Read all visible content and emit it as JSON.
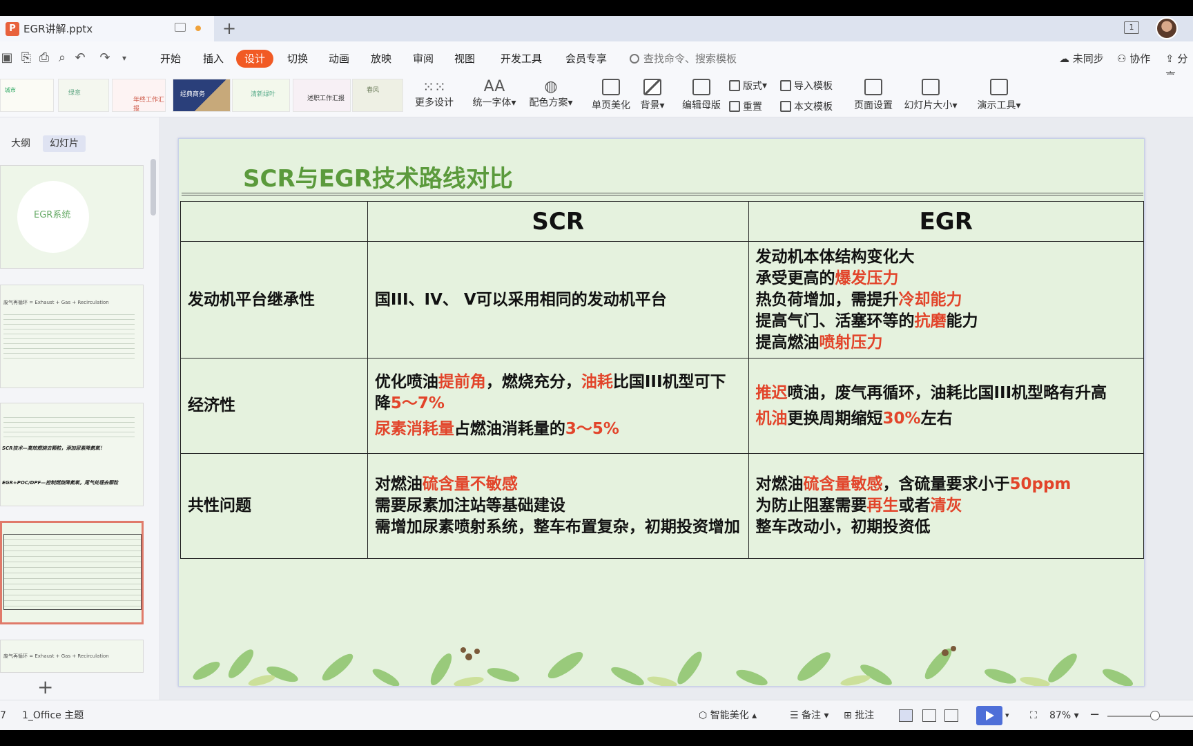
{
  "window": {
    "doc_title": "EGR讲解.pptx",
    "window_counter": "1"
  },
  "menu": {
    "items": [
      "开始",
      "插入",
      "设计",
      "切换",
      "动画",
      "放映",
      "审阅",
      "视图",
      "开发工具",
      "会员专享"
    ],
    "active": "设计",
    "search_placeholder": "查找命令、搜索模板",
    "sync": "未同步",
    "collab": "协作",
    "share": "分享"
  },
  "ribbon": {
    "more_design": "更多设计",
    "unify_font": "统一字体",
    "color_scheme": "配色方案",
    "single_page": "单页美化",
    "background": "背景",
    "edit_master": "编辑母版",
    "layout": "版式",
    "import_template": "导入模板",
    "reset": "重置",
    "this_template": "本文模板",
    "page_setup": "页面设置",
    "slide_size": "幻灯片大小",
    "present_tools": "演示工具",
    "template_thumb_texts": [
      "城市",
      "绿意",
      "年终工作汇报",
      "经典商务",
      "清新绿叶",
      "述职工作汇报",
      "春风"
    ]
  },
  "leftpanel": {
    "tab_outline": "大纲",
    "tab_slides": "幻灯片",
    "thumb1_title": "EGR系统",
    "thumb3_line1": "SCR技术—高效燃烧去颗粒，添加尿素降氮氧！",
    "thumb3_line2": "EGR+POC/DPF—控制燃烧降氮氧，尾气处理去颗粒",
    "thumb2_line": "废气再循环 = Exhaust + Gas + Recirculation",
    "thumb5_line": "废气再循环 = Exhaust + Gas + Recirculation"
  },
  "slide": {
    "title": "SCR与EGR技术路线对比",
    "header_scr": "SCR",
    "header_egr": "EGR",
    "row1_label": "发动机平台继承性",
    "row1_scr": "国III、IV、 V可以采用相同的发动机平台",
    "row1_egr_l1": "发动机本体结构变化大",
    "row1_egr_l2a": "承受更高的",
    "row1_egr_l2b": "爆发压力",
    "row1_egr_l3a": "热负荷增加，需提升",
    "row1_egr_l3b": "冷却能力",
    "row1_egr_l4a": "提高气门、活塞环等的",
    "row1_egr_l4b": "抗磨",
    "row1_egr_l4c": "能力",
    "row1_egr_l5a": "提高燃油",
    "row1_egr_l5b": "喷射压力",
    "row2_label": "经济性",
    "row2_scr_a": "优化喷油",
    "row2_scr_b": "提前角",
    "row2_scr_c": "，燃烧充分，",
    "row2_scr_d": "油耗",
    "row2_scr_e": "比国III机型可下降",
    "row2_scr_f": "5～7%",
    "row2_scr_g": "尿素消耗量",
    "row2_scr_h": "占燃油消耗量的",
    "row2_scr_i": "3～5%",
    "row2_egr_a": "推迟",
    "row2_egr_b": "喷油，废气再循环，油耗比国III机型略有升高",
    "row2_egr_c": "机油",
    "row2_egr_d": "更换周期缩短",
    "row2_egr_e": "30%",
    "row2_egr_f": "左右",
    "row3_label": "共性问题",
    "row3_scr_a": "对燃油",
    "row3_scr_b": "硫含量不敏感",
    "row3_scr_c": "需要尿素加注站等基础建设",
    "row3_scr_d": "需增加尿素喷射系统，整车布置复杂，初期投资增加",
    "row3_egr_a": "对燃油",
    "row3_egr_b": "硫含量敏感",
    "row3_egr_c": "，含硫量要求小于",
    "row3_egr_d": "50ppm",
    "row3_egr_e": "为防止阻塞需要",
    "row3_egr_f": "再生",
    "row3_egr_g": "或者",
    "row3_egr_h": "清灰",
    "row3_egr_i": "整车改动小，初期投资低"
  },
  "status": {
    "slide_num": "7",
    "theme": "1_Office 主题",
    "smart_beautify": "智能美化",
    "notes": "备注",
    "comments": "批注",
    "zoom": "87%"
  },
  "colors": {
    "accent": "#f15a24",
    "title_green": "#5b9a3c",
    "highlight_red": "#e2442a",
    "slide_bg": "#e5f2de"
  }
}
